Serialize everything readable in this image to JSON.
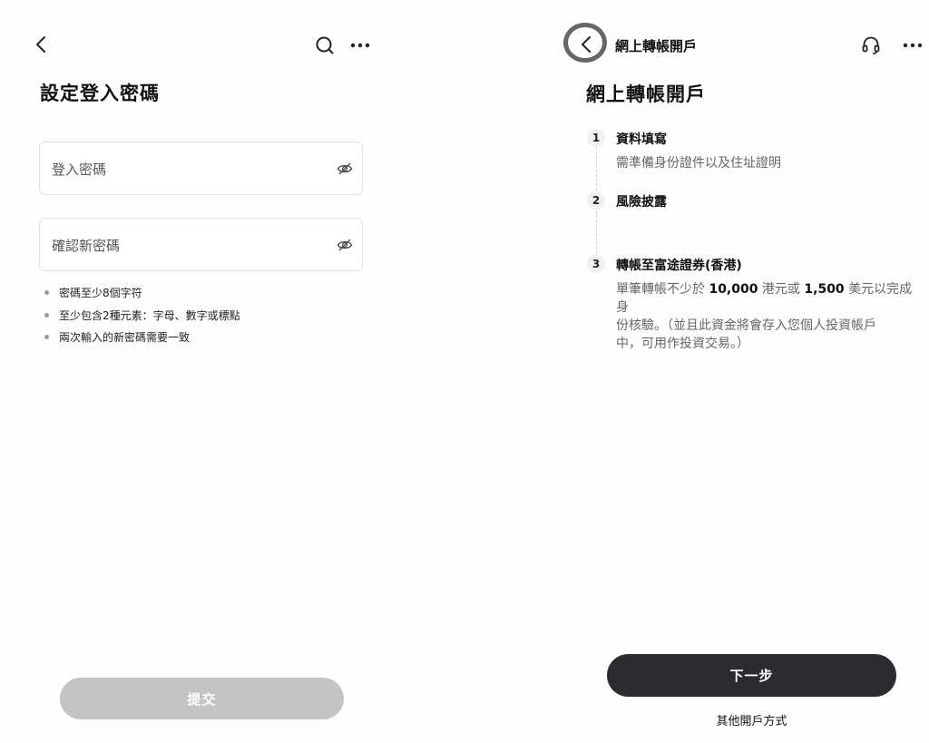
{
  "left": {
    "page_title": "設定登入密碼",
    "password_placeholder": "登入密碼",
    "confirm_placeholder": "確認新密碼",
    "rules": [
      "密碼至少8個字符",
      "至少包含2種元素：字母、數字或標點",
      "兩次輸入的新密碼需要一致"
    ],
    "submit_label": "提交",
    "icons": [
      "back-icon",
      "search-icon",
      "more-icon",
      "eye-hidden-icon"
    ]
  },
  "right": {
    "header_title": "網上轉帳開戶",
    "page_title": "網上轉帳開戶",
    "steps": [
      {
        "num": "1",
        "title": "資料填寫",
        "desc": "需準備身份證件以及住址證明"
      },
      {
        "num": "2",
        "title": "風險披露",
        "desc": ""
      },
      {
        "num": "3",
        "title": "轉帳至富途證券(香港)",
        "desc_line1_a": "單筆轉帳不少於 ",
        "desc_amount_hkd": "10,000",
        "desc_line1_b": " 港元或 ",
        "desc_amount_usd": "1,500",
        "desc_line1_c": " 美元以完成身",
        "desc_line2": "份核驗。（並且此資金將會存入您個人投資帳戶",
        "desc_line3": "中，可用作投資交易。）"
      }
    ],
    "next_label": "下一步",
    "other_method_label": "其他開戶方式",
    "icons": [
      "back-icon",
      "headset-icon",
      "more-icon"
    ]
  },
  "colors": {
    "primary_button": "#2a2c30",
    "disabled_button": "#c4c4c4",
    "highlight_ring": "#666666"
  }
}
